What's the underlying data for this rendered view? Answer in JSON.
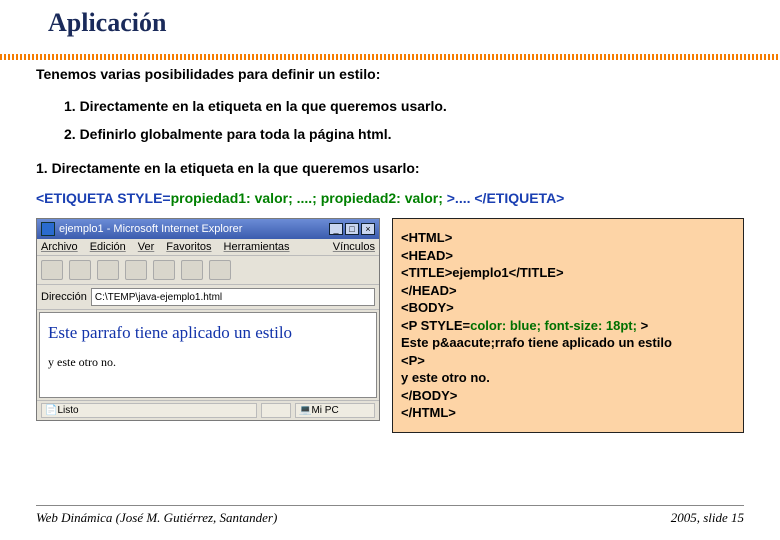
{
  "title": "Aplicación",
  "intro": "Tenemos varias posibilidades para definir un estilo:",
  "item1": "1. Directamente en la etiqueta en la que queremos usarlo.",
  "item2": "2. Definirlo globalmente para toda la página html.",
  "subhead": "1. Directamente en la etiqueta en la que queremos usarlo:",
  "codeline": {
    "p1": "<ETIQUETA ",
    "p2": "STYLE=",
    "p3": "propiedad1: valor; ....; propiedad2: valor; ",
    "p4": ">.... </ETIQUETA>"
  },
  "ie": {
    "title": "ejemplo1 - Microsoft Internet Explorer",
    "menu": {
      "a": "Archivo",
      "b": "Edición",
      "c": "Ver",
      "d": "Favoritos",
      "e": "Herramientas",
      "f": "Vínculos"
    },
    "addr_label": "Dirección",
    "addr_value": "C:\\TEMP\\java-ejemplo1.html",
    "body_p1": "Este parrafo tiene aplicado un estilo",
    "body_p2": "y este otro no.",
    "status_ready": "Listo",
    "status_zone": "Mi PC"
  },
  "code": {
    "l1": "<HTML>",
    "l2": "<HEAD>",
    "l3": "<TITLE>ejemplo1</TITLE>",
    "l4": "</HEAD>",
    "l5": "<BODY>",
    "l6a": "<P STYLE=",
    "l6b": "color: blue; font-size: 18pt; ",
    "l6c": ">",
    "l7": "Este p&aacute;rrafo tiene aplicado un estilo",
    "l8": "<P>",
    "l9": "y este otro no.",
    "l10": "</BODY>",
    "l11": "</HTML>"
  },
  "footer": {
    "left": "Web Dinámica (José M. Gutiérrez, Santander)",
    "right": "2005, slide 15"
  }
}
